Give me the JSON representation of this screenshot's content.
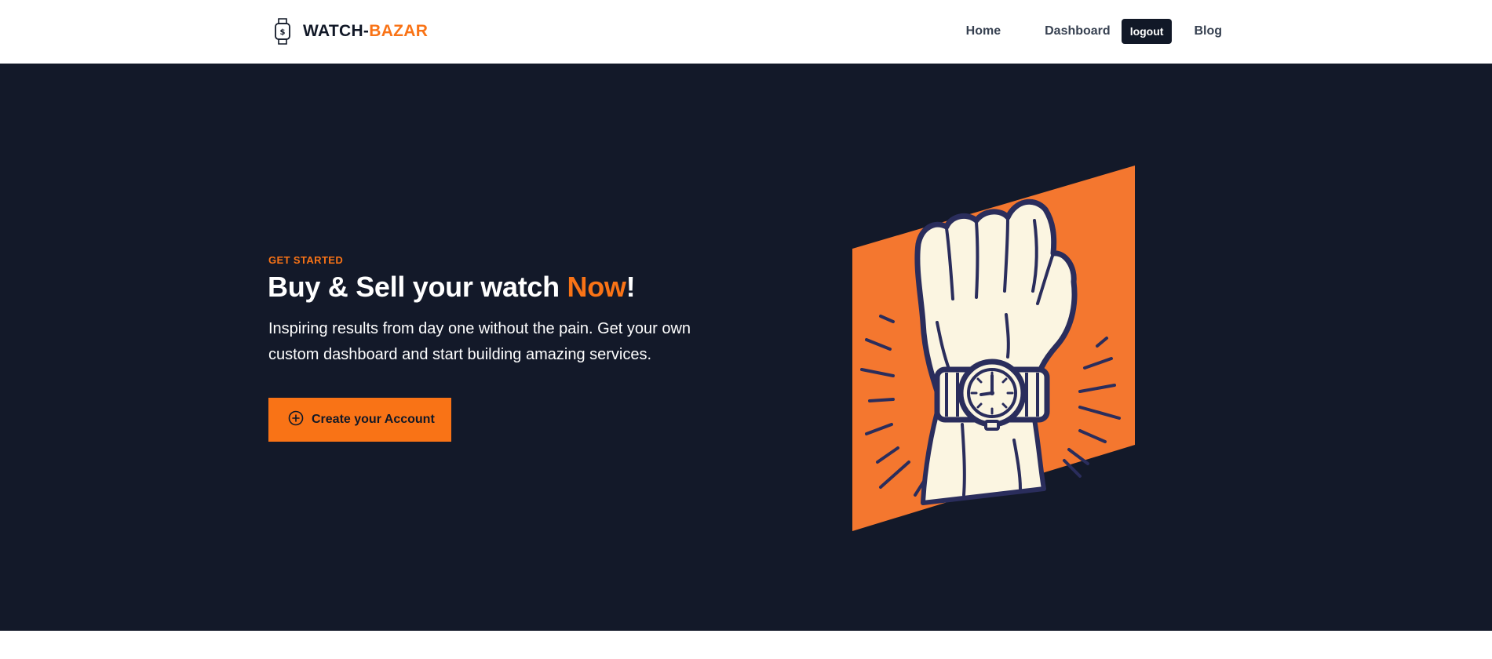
{
  "navbar": {
    "brand_part1": "WATCH-",
    "brand_part2": "BAZAR",
    "brand_icon": "smartwatch-dollar-icon",
    "links": {
      "home": "Home",
      "dashboard": "Dashboard",
      "logout": "logout",
      "blog": "Blog"
    }
  },
  "hero": {
    "eyebrow": "GET STARTED",
    "headline_part1": "Buy & Sell your watch ",
    "headline_accent": "Now",
    "headline_part2": "!",
    "subtext": "Inspiring results from day one without the pain. Get your own custom dashboard and start building amazing services.",
    "cta_label": "Create your Account",
    "cta_icon": "plus-circle-icon",
    "illustration": "fist-with-wristwatch-illustration"
  },
  "colors": {
    "accent": "#f97316",
    "hero_bg": "#131929",
    "dark": "#111827",
    "illustration_navy": "#2a2d5c",
    "illustration_cream": "#fbf5e1"
  }
}
